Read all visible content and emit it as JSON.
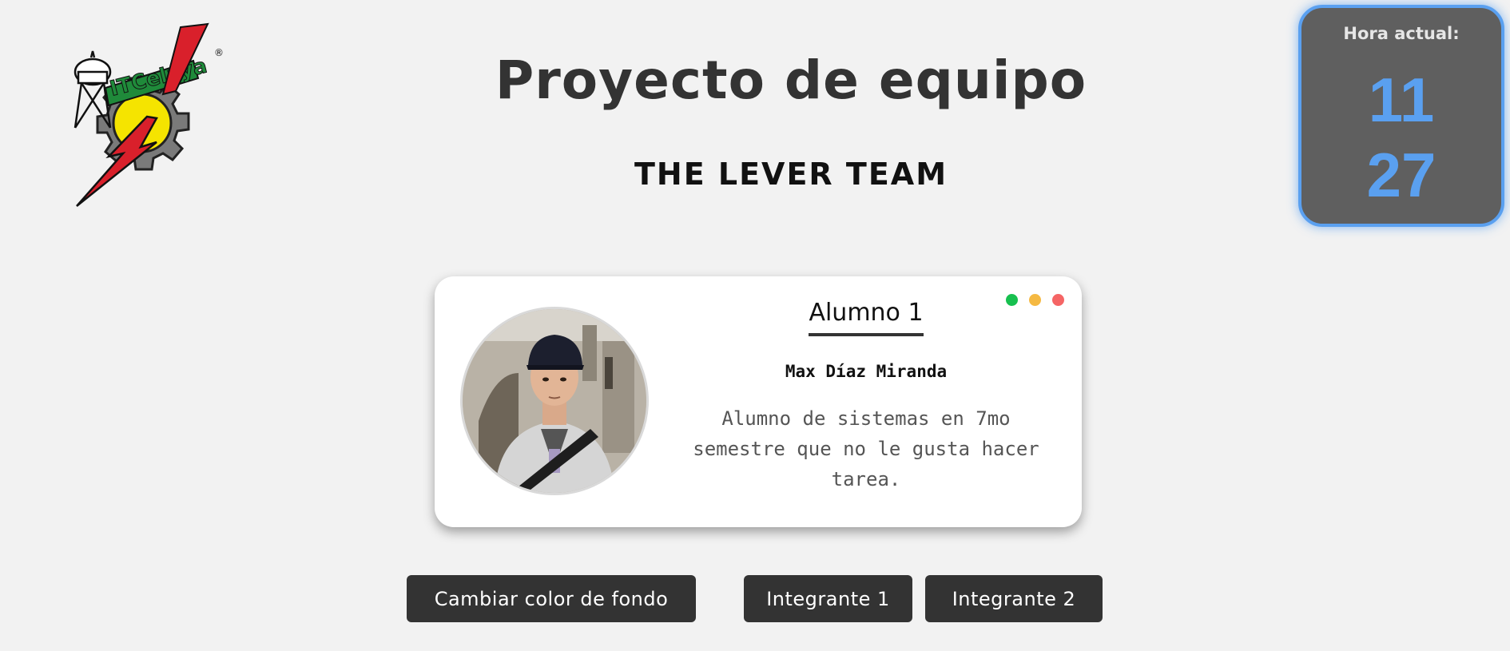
{
  "header": {
    "title": "Proyecto de equipo",
    "subtitle": "THE LEVER TEAM",
    "logo": {
      "icon": "itcelaya-logo",
      "text": "ITCelaya"
    }
  },
  "clock": {
    "label": "Hora actual:",
    "hour": "11",
    "minute": "27",
    "accent_color": "#5aa0f0"
  },
  "card": {
    "heading": "Alumno 1",
    "name": "Max Díaz Miranda",
    "description": "Alumno de sistemas en 7mo semestre que no le gusta hacer tarea.",
    "avatar_icon": "student-photo",
    "window_dots": [
      "#17c04f",
      "#f5b942",
      "#f56565"
    ]
  },
  "buttons": {
    "change_bg": "Cambiar color de fondo",
    "member1": "Integrante 1",
    "member2": "Integrante 2"
  }
}
